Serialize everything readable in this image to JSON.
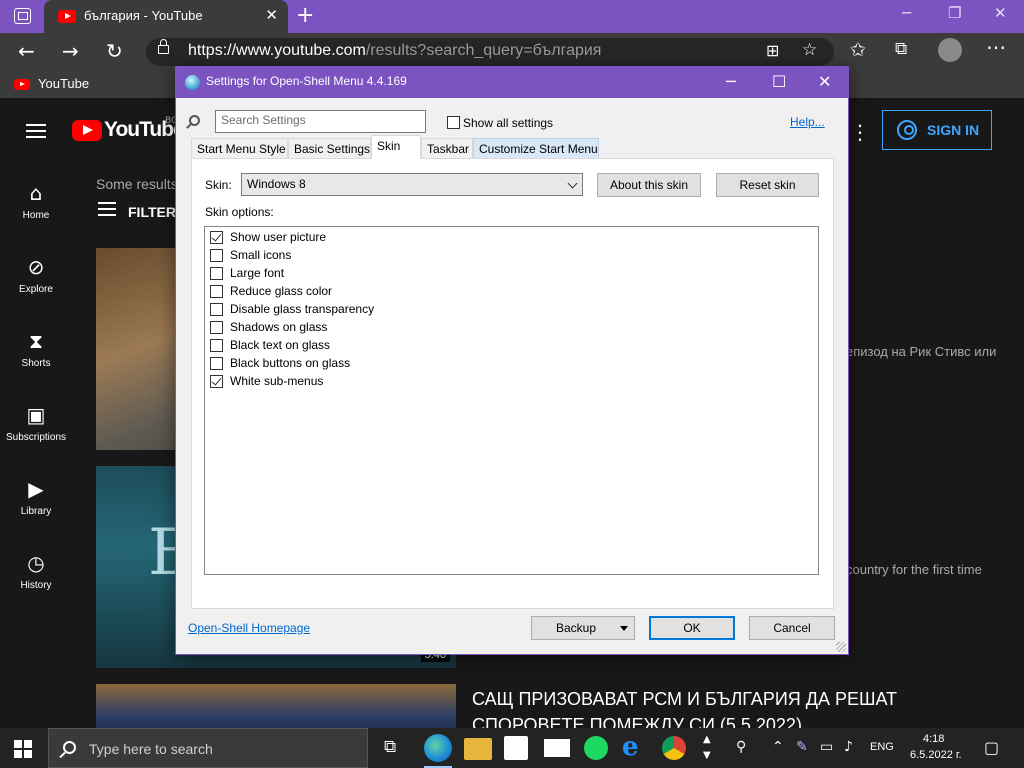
{
  "browser": {
    "tab_title": "българия - YouTube",
    "close_tab_glyph": "✕",
    "new_tab_glyph": "+",
    "url_host": "https://www.youtube.com",
    "url_rest": "/results?search_query=българия",
    "bookmark_label": "YouTube"
  },
  "youtube": {
    "logo_text": "YouTube",
    "country_code": "BG",
    "sign_in_label": "SIGN IN",
    "nav": [
      {
        "label": "Home",
        "icon": "home-icon"
      },
      {
        "label": "Explore",
        "icon": "compass-icon"
      },
      {
        "label": "Shorts",
        "icon": "shorts-icon"
      },
      {
        "label": "Subscriptions",
        "icon": "subscriptions-icon"
      },
      {
        "label": "Library",
        "icon": "library-icon"
      },
      {
        "label": "History",
        "icon": "history-icon"
      }
    ],
    "results_note": "Some results",
    "filter_label": "FILTER",
    "video1_snippet": "епизод на Рик Стивс или",
    "video2_snippet": "country for the first time",
    "video2_duration": "5:46",
    "video3_title": "САЩ ПРИЗОВАВАТ РСМ И БЪЛГАРИЯ ДА РЕШАТ СПОРОВЕТЕ ПОМЕЖДУ СИ (5.5.2022)"
  },
  "dialog": {
    "title": "Settings for Open-Shell Menu 4.4.169",
    "search_placeholder": "Search Settings",
    "show_all_label": "Show all settings",
    "show_all_checked": false,
    "help_link": "Help...",
    "tabs": [
      {
        "label": "Start Menu Style",
        "active": false
      },
      {
        "label": "Basic Settings",
        "active": false
      },
      {
        "label": "Skin",
        "active": true
      },
      {
        "label": "Taskbar",
        "active": false
      },
      {
        "label": "Customize Start Menu",
        "active": false
      }
    ],
    "skin_label": "Skin:",
    "skin_value": "Windows 8",
    "about_skin_button": "About this skin",
    "reset_skin_button": "Reset skin",
    "skin_options_label": "Skin options:",
    "options": [
      {
        "label": "Show user picture",
        "checked": true
      },
      {
        "label": "Small icons",
        "checked": false
      },
      {
        "label": "Large font",
        "checked": false
      },
      {
        "label": "Reduce glass color",
        "checked": false
      },
      {
        "label": "Disable glass transparency",
        "checked": false
      },
      {
        "label": "Shadows on glass",
        "checked": false
      },
      {
        "label": "Black text on glass",
        "checked": false
      },
      {
        "label": "Black buttons on glass",
        "checked": false
      },
      {
        "label": "White sub-menus",
        "checked": true
      }
    ],
    "homepage_link": "Open-Shell Homepage",
    "backup_button": "Backup",
    "ok_button": "OK",
    "cancel_button": "Cancel"
  },
  "taskbar": {
    "search_placeholder": "Type here to search",
    "language": "ENG",
    "time": "4:18",
    "date": "6.5.2022 г."
  },
  "colors": {
    "accent": "#7b54c2",
    "youtube_red": "#ff0000",
    "link_blue": "#0066cc",
    "sign_in_blue": "#3ea6ff"
  }
}
